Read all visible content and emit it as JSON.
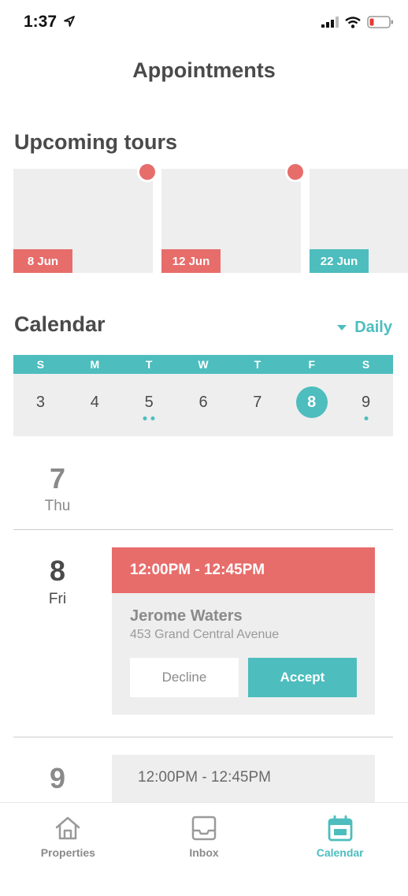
{
  "status_bar": {
    "time": "1:37"
  },
  "header": {
    "title": "Appointments"
  },
  "upcoming": {
    "title": "Upcoming tours",
    "tours": [
      {
        "date": "8 Jun",
        "color": "#e76d6b",
        "has_alert": true
      },
      {
        "date": "12 Jun",
        "color": "#e76d6b",
        "has_alert": true
      },
      {
        "date": "22 Jun",
        "color": "#4dbdbe",
        "has_alert": false
      }
    ]
  },
  "calendar": {
    "title": "Calendar",
    "view_label": "Daily",
    "weekday_headers": [
      "S",
      "M",
      "T",
      "W",
      "T",
      "F",
      "S"
    ],
    "days": [
      {
        "num": "3",
        "dots": 0,
        "selected": false
      },
      {
        "num": "4",
        "dots": 0,
        "selected": false
      },
      {
        "num": "5",
        "dots": 2,
        "selected": false
      },
      {
        "num": "6",
        "dots": 0,
        "selected": false
      },
      {
        "num": "7",
        "dots": 0,
        "selected": false
      },
      {
        "num": "8",
        "dots": 0,
        "selected": true
      },
      {
        "num": "9",
        "dots": 1,
        "selected": false
      }
    ]
  },
  "schedule": [
    {
      "day": "7",
      "weekday": "Thu"
    },
    {
      "day": "8",
      "weekday": "Fri",
      "appointment": {
        "time": "12:00PM - 12:45PM",
        "name": "Jerome Waters",
        "address": "453 Grand Central Avenue",
        "decline_label": "Decline",
        "accept_label": "Accept"
      }
    },
    {
      "day": "9",
      "appointment": {
        "time": "12:00PM - 12:45PM"
      }
    }
  ],
  "tabbar": {
    "tabs": [
      {
        "label": "Properties",
        "icon": "home-icon",
        "active": false
      },
      {
        "label": "Inbox",
        "icon": "inbox-icon",
        "active": false
      },
      {
        "label": "Calendar",
        "icon": "calendar-icon",
        "active": true
      }
    ]
  },
  "colors": {
    "accent": "#4dbdbe",
    "alert": "#e76d6b",
    "card_bg": "#eeeeee"
  }
}
